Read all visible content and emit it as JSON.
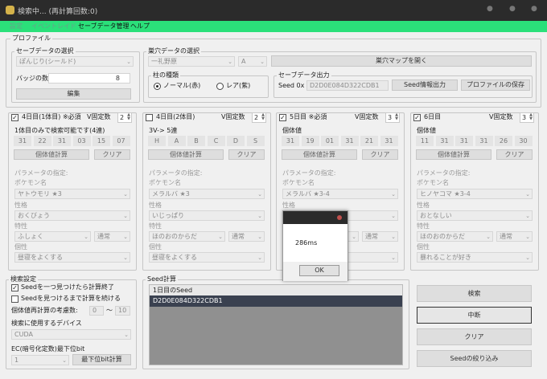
{
  "window": {
    "title": "検索中... (再計算回数:0)",
    "controls": [
      "●",
      "●",
      "●"
    ]
  },
  "menu": [
    "設定",
    "イベントレイド",
    "セーブデータ管理",
    "ヘルプ"
  ],
  "profile": {
    "label": "プロファイル",
    "save_select": {
      "label": "セーブデータの選択",
      "value": "ぽんじり(シールド)"
    },
    "badge": {
      "label": "バッジの数",
      "value": "8"
    },
    "edit": "編集"
  },
  "nest": {
    "label": "巣穴データの選択",
    "location": "一礼野原",
    "letter": "A",
    "map_btn": "巣穴マップを開く",
    "type_label": "柱の種類",
    "normal": "ノーマル(赤)",
    "rare": "レア(紫)",
    "out_label": "セーブデータ出力",
    "seed_prefix": "Seed 0x",
    "seed_value": "D2D0E084D322CDB1",
    "seed_info": "Seed情報出力",
    "save_profile": "プロファイルの保存"
  },
  "days": [
    {
      "checked": true,
      "title": "4日目(1体目) ※必須",
      "fixed_label": "V固定数",
      "fixed": "2",
      "sub": "1体目のみで検索可能です(4連)",
      "ivs": [
        "31",
        "22",
        "31",
        "03",
        "15",
        "07"
      ],
      "calc": "個体値計算",
      "clear": "クリア",
      "params": "パラメータの指定:",
      "poke_label": "ポケモン名",
      "poke": "ヤトウモリ ★3",
      "nature_label": "性格",
      "nature": "おくびょう",
      "ability_label": "特性",
      "ability": "ふしょく",
      "ability2": "通常",
      "char_label": "個性",
      "char": "昼寝をよくする"
    },
    {
      "checked": false,
      "title": "4日目(2体目)",
      "fixed_label": "V固定数",
      "fixed": "2",
      "sub": "3V->  5連",
      "ivs": [
        "H",
        "A",
        "B",
        "C",
        "D",
        "S"
      ],
      "calc": "個体値計算",
      "clear": "クリア",
      "params": "パラメータの指定:",
      "poke_label": "ポケモン名",
      "poke": "メラルバ ★3",
      "nature_label": "性格",
      "nature": "いじっぱり",
      "ability_label": "特性",
      "ability": "ほのおのからだ",
      "ability2": "通常",
      "char_label": "個性",
      "char": "昼寝をよくする"
    },
    {
      "checked": true,
      "title": "5日目 ※必須",
      "fixed_label": "V固定数",
      "fixed": "3",
      "sub": "個体値",
      "ivs": [
        "31",
        "19",
        "01",
        "31",
        "21",
        "31"
      ],
      "calc": "個体値計算",
      "clear": "クリア",
      "params": "パラメータの指定:",
      "poke_label": "ポケモン名",
      "poke": "メラルバ ★3-4",
      "nature_label": "性格",
      "nature": "",
      "ability_label": "特性",
      "ability": "",
      "ability2": "通常",
      "char_label": "個性",
      "char": ""
    },
    {
      "checked": true,
      "title": "6日目",
      "fixed_label": "V固定数",
      "fixed": "3",
      "sub": "個体値",
      "ivs": [
        "11",
        "31",
        "31",
        "31",
        "26",
        "30"
      ],
      "calc": "個体値計算",
      "clear": "クリア",
      "params": "パラメータの指定:",
      "poke_label": "ポケモン名",
      "poke": "ヒノヤコマ ★3-4",
      "nature_label": "性格",
      "nature": "おとなしい",
      "ability_label": "特性",
      "ability": "ほのおのからだ",
      "ability2": "通常",
      "char_label": "個性",
      "char": "暴れることが好き"
    }
  ],
  "search": {
    "label": "検索設定",
    "opt1": "Seedを一つ見つけたら計算終了",
    "opt2": "Seedを見つけるまで計算を続ける",
    "iv_range_label": "個体値再計算の考慮数:",
    "iv_min": "0",
    "tilde": "～",
    "iv_max": "10",
    "device_label": "検索に使用するデバイス",
    "device": "CUDA",
    "ec_label": "EC(暗号化定数)最下位bit",
    "ec_value": "1",
    "ec_btn": "最下位bit計算"
  },
  "seedcalc": {
    "label": "Seed計算",
    "header": "1日目のSeed",
    "rows": [
      "D2D0E084D322CDB1"
    ]
  },
  "actions": {
    "search": "検索",
    "stop": "中断",
    "clear": "クリア",
    "narrow": "Seedの絞り込み"
  },
  "dialog": {
    "message": "286ms",
    "ok": "OK"
  },
  "colors": {
    "accent": "#2be07a",
    "titlebar": "#2b2b2b",
    "selected": "#3a4150"
  }
}
